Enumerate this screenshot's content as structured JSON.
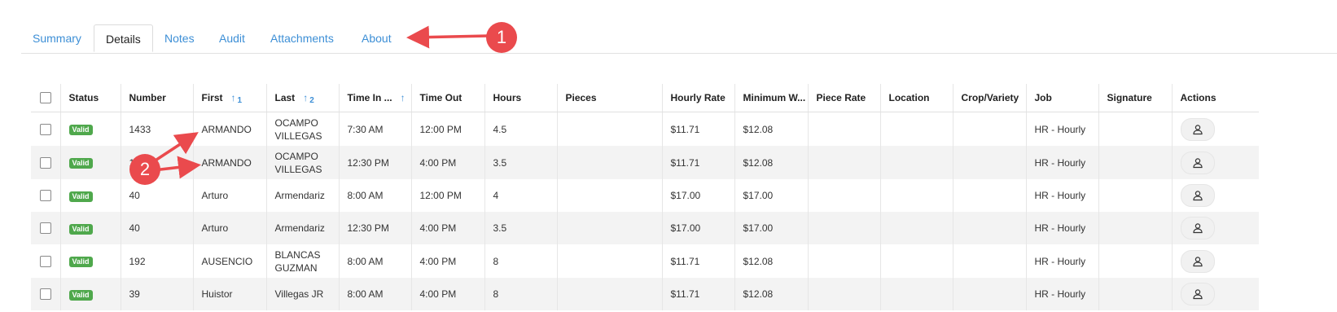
{
  "tabs": [
    {
      "label": "Summary",
      "active": false
    },
    {
      "label": "Details",
      "active": true
    },
    {
      "label": "Notes",
      "active": false
    },
    {
      "label": "Audit",
      "active": false
    },
    {
      "label": "Attachments",
      "active": false
    },
    {
      "label": "About",
      "active": false
    }
  ],
  "columns": {
    "status": "Status",
    "number": "Number",
    "first": "First",
    "first_sort": "1",
    "last": "Last",
    "last_sort": "2",
    "time_in": "Time In ...",
    "time_out": "Time Out",
    "hours": "Hours",
    "pieces": "Pieces",
    "hourly_rate": "Hourly Rate",
    "minimum_wage": "Minimum W...",
    "piece_rate": "Piece Rate",
    "location": "Location",
    "crop_variety": "Crop/Variety",
    "job": "Job",
    "signature": "Signature",
    "actions": "Actions"
  },
  "rows": [
    {
      "status": "Valid",
      "number": "1433",
      "first": "ARMANDO",
      "last": "OCAMPO VILLEGAS",
      "time_in": "7:30 AM",
      "time_out": "12:00 PM",
      "hours": "4.5",
      "pieces": "",
      "hourly_rate": "$11.71",
      "minimum_wage": "$12.08",
      "piece_rate": "",
      "location": "",
      "crop_variety": "",
      "job": "HR - Hourly",
      "signature": ""
    },
    {
      "status": "Valid",
      "number": "1",
      "first": "ARMANDO",
      "last": "OCAMPO VILLEGAS",
      "time_in": "12:30 PM",
      "time_out": "4:00 PM",
      "hours": "3.5",
      "pieces": "",
      "hourly_rate": "$11.71",
      "minimum_wage": "$12.08",
      "piece_rate": "",
      "location": "",
      "crop_variety": "",
      "job": "HR - Hourly",
      "signature": ""
    },
    {
      "status": "Valid",
      "number": "40",
      "first": "Arturo",
      "last": "Armendariz",
      "time_in": "8:00 AM",
      "time_out": "12:00 PM",
      "hours": "4",
      "pieces": "",
      "hourly_rate": "$17.00",
      "minimum_wage": "$17.00",
      "piece_rate": "",
      "location": "",
      "crop_variety": "",
      "job": "HR - Hourly",
      "signature": ""
    },
    {
      "status": "Valid",
      "number": "40",
      "first": "Arturo",
      "last": "Armendariz",
      "time_in": "12:30 PM",
      "time_out": "4:00 PM",
      "hours": "3.5",
      "pieces": "",
      "hourly_rate": "$17.00",
      "minimum_wage": "$17.00",
      "piece_rate": "",
      "location": "",
      "crop_variety": "",
      "job": "HR - Hourly",
      "signature": ""
    },
    {
      "status": "Valid",
      "number": "192",
      "first": "AUSENCIO",
      "last": "BLANCAS GUZMAN",
      "time_in": "8:00 AM",
      "time_out": "4:00 PM",
      "hours": "8",
      "pieces": "",
      "hourly_rate": "$11.71",
      "minimum_wage": "$12.08",
      "piece_rate": "",
      "location": "",
      "crop_variety": "",
      "job": "HR - Hourly",
      "signature": ""
    },
    {
      "status": "Valid",
      "number": "39",
      "first": "Huistor",
      "last": "Villegas JR",
      "time_in": "8:00 AM",
      "time_out": "4:00 PM",
      "hours": "8",
      "pieces": "",
      "hourly_rate": "$11.71",
      "minimum_wage": "$12.08",
      "piece_rate": "",
      "location": "",
      "crop_variety": "",
      "job": "HR - Hourly",
      "signature": ""
    }
  ],
  "annotations": {
    "marker_1": "1",
    "marker_2": "2",
    "color": "#ea4a4d"
  },
  "colors": {
    "accent": "#3d8fd6",
    "valid_badge": "#4fa84c",
    "alt_row": "#f3f3f3"
  },
  "icons": {
    "action": "person-icon",
    "sort": "arrow-up-icon"
  }
}
